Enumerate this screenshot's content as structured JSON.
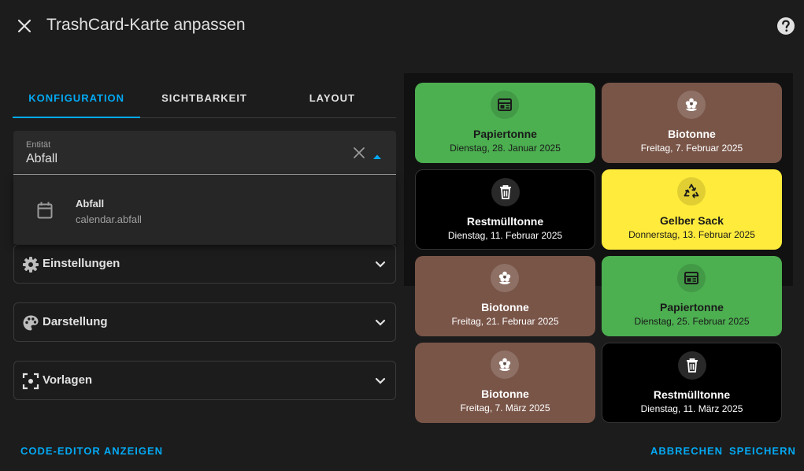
{
  "dialog": {
    "title": "TrashCard-Karte anpassen",
    "close_icon": "close-icon",
    "help_icon": "help-circle-icon"
  },
  "tabs": [
    {
      "label": "KONFIGURATION",
      "active": true
    },
    {
      "label": "SICHTBARKEIT",
      "active": false
    },
    {
      "label": "LAYOUT",
      "active": false
    }
  ],
  "entity": {
    "label": "Entität",
    "value": "Abfall",
    "clear_icon": "close-icon",
    "caret_icon": "menu-up-icon"
  },
  "dropdown": {
    "option": {
      "name": "Abfall",
      "entity_id": "calendar.abfall",
      "icon": "calendar-icon"
    }
  },
  "panels": [
    {
      "label": "Einstellungen",
      "icon": "gear-icon"
    },
    {
      "label": "Darstellung",
      "icon": "palette-icon"
    },
    {
      "label": "Vorlagen",
      "icon": "focus-frame-icon"
    }
  ],
  "cards": [
    {
      "name": "Papiertonne",
      "date": "Dienstag, 28. Januar 2025",
      "icon": "newspaper-icon",
      "bg": "#4caf50",
      "fg": "#1a1a1a"
    },
    {
      "name": "Biotonne",
      "date": "Freitag, 7. Februar 2025",
      "icon": "flower-icon",
      "bg": "#795548",
      "fg": "#ffffff"
    },
    {
      "name": "Restmülltonne",
      "date": "Dienstag, 11. Februar 2025",
      "icon": "trash-can-icon",
      "bg": "#000000",
      "fg": "#ffffff"
    },
    {
      "name": "Gelber Sack",
      "date": "Donnerstag, 13. Februar 2025",
      "icon": "recycle-icon",
      "bg": "#ffeb3b",
      "fg": "#1a1a1a"
    },
    {
      "name": "Biotonne",
      "date": "Freitag, 21. Februar 2025",
      "icon": "flower-icon",
      "bg": "#795548",
      "fg": "#ffffff"
    },
    {
      "name": "Papiertonne",
      "date": "Dienstag, 25. Februar 2025",
      "icon": "newspaper-icon",
      "bg": "#4caf50",
      "fg": "#1a1a1a"
    },
    {
      "name": "Biotonne",
      "date": "Freitag, 7. März 2025",
      "icon": "flower-icon",
      "bg": "#795548",
      "fg": "#ffffff"
    },
    {
      "name": "Restmülltonne",
      "date": "Dienstag, 11. März 2025",
      "icon": "trash-can-icon",
      "bg": "#000000",
      "fg": "#ffffff"
    }
  ],
  "footer": {
    "code_editor": "CODE-EDITOR ANZEIGEN",
    "cancel": "ABBRECHEN",
    "save": "SPEICHERN"
  },
  "colors": {
    "accent": "#03a9f4",
    "background": "#1c1c1c",
    "green": "#4caf50",
    "brown": "#795548",
    "black": "#000000",
    "yellow": "#ffeb3b"
  }
}
